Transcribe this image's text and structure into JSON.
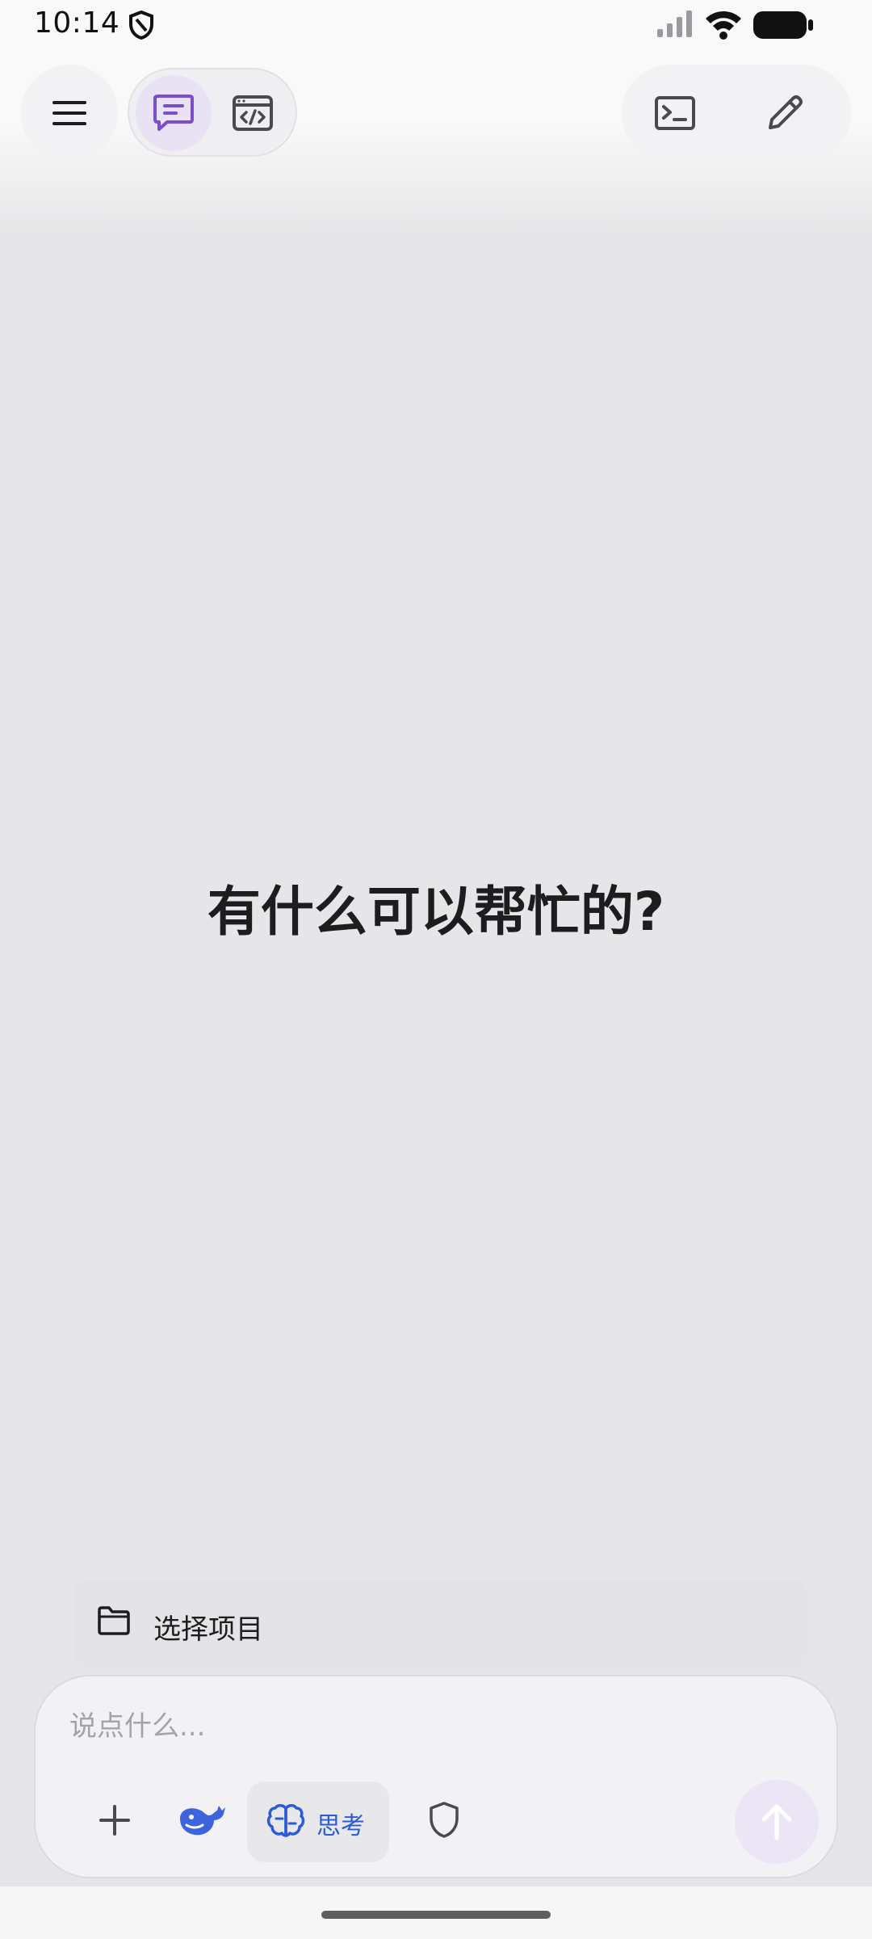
{
  "status_bar": {
    "time": "10:14",
    "icons": [
      "shield-status-icon",
      "signal-icon",
      "wifi-icon",
      "battery-icon"
    ]
  },
  "top_bar": {
    "menu_icon": "hamburger-menu-icon",
    "mode_toggle": [
      {
        "name": "chat-mode",
        "icon": "chat-bubble-icon",
        "selected": true
      },
      {
        "name": "code-mode",
        "icon": "code-window-icon",
        "selected": false
      }
    ],
    "actions": [
      {
        "name": "terminal",
        "icon": "terminal-icon"
      },
      {
        "name": "new-chat",
        "icon": "pencil-icon"
      }
    ]
  },
  "main": {
    "greeting": "有什么可以帮忙的?"
  },
  "project": {
    "label": "选择项目",
    "icon": "folder-icon"
  },
  "composer": {
    "placeholder": "说点什么...",
    "value": "",
    "tools": {
      "add_icon": "plus-icon",
      "model_icon": "deepseek-whale-icon",
      "think_label": "思考",
      "think_icon": "brain-icon",
      "privacy_icon": "shield-icon",
      "send_icon": "arrow-up-icon"
    }
  },
  "colors": {
    "accent_purple": "#7b4fc9",
    "accent_blue": "#2b5bd7",
    "background": "#e6e6e8",
    "send_button_bg": "#ebe5f6"
  }
}
